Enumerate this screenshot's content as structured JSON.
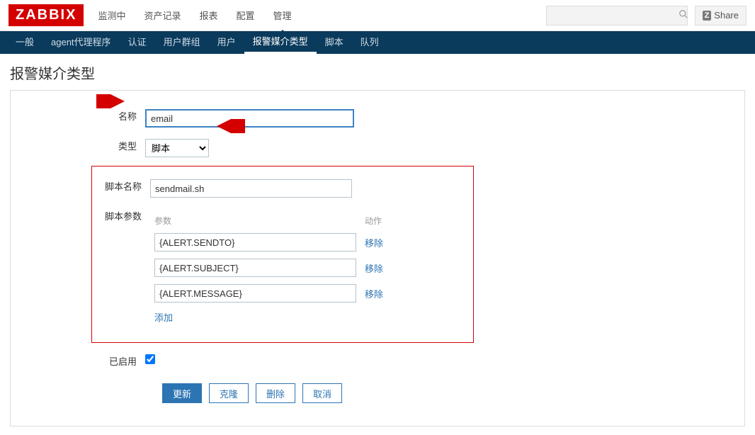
{
  "brand": "ZABBIX",
  "topnav": {
    "items": [
      "监测中",
      "资产记录",
      "报表",
      "配置",
      "管理"
    ],
    "active_index": 4
  },
  "search": {
    "placeholder": ""
  },
  "share": {
    "label": "Share"
  },
  "subnav": {
    "items": [
      "一般",
      "agent代理程序",
      "认证",
      "用户群组",
      "用户",
      "报警媒介类型",
      "脚本",
      "队列"
    ],
    "active_index": 5
  },
  "page_title": "报警媒介类型",
  "form": {
    "name_label": "名称",
    "name_value": "email",
    "type_label": "类型",
    "type_value": "脚本",
    "script_name_label": "脚本名称",
    "script_name_value": "sendmail.sh",
    "params_label": "脚本参数",
    "params_header_param": "参数",
    "params_header_action": "动作",
    "params": [
      {
        "value": "{ALERT.SENDTO}"
      },
      {
        "value": "{ALERT.SUBJECT}"
      },
      {
        "value": "{ALERT.MESSAGE}"
      }
    ],
    "remove_label": "移除",
    "add_label": "添加",
    "enabled_label": "已启用",
    "enabled_checked": true
  },
  "buttons": {
    "update": "更新",
    "clone": "克隆",
    "delete": "删除",
    "cancel": "取消"
  },
  "colors": {
    "highlight_border": "#d40000",
    "primary": "#2d74b3",
    "subnav_bg": "#0a3a5c"
  }
}
